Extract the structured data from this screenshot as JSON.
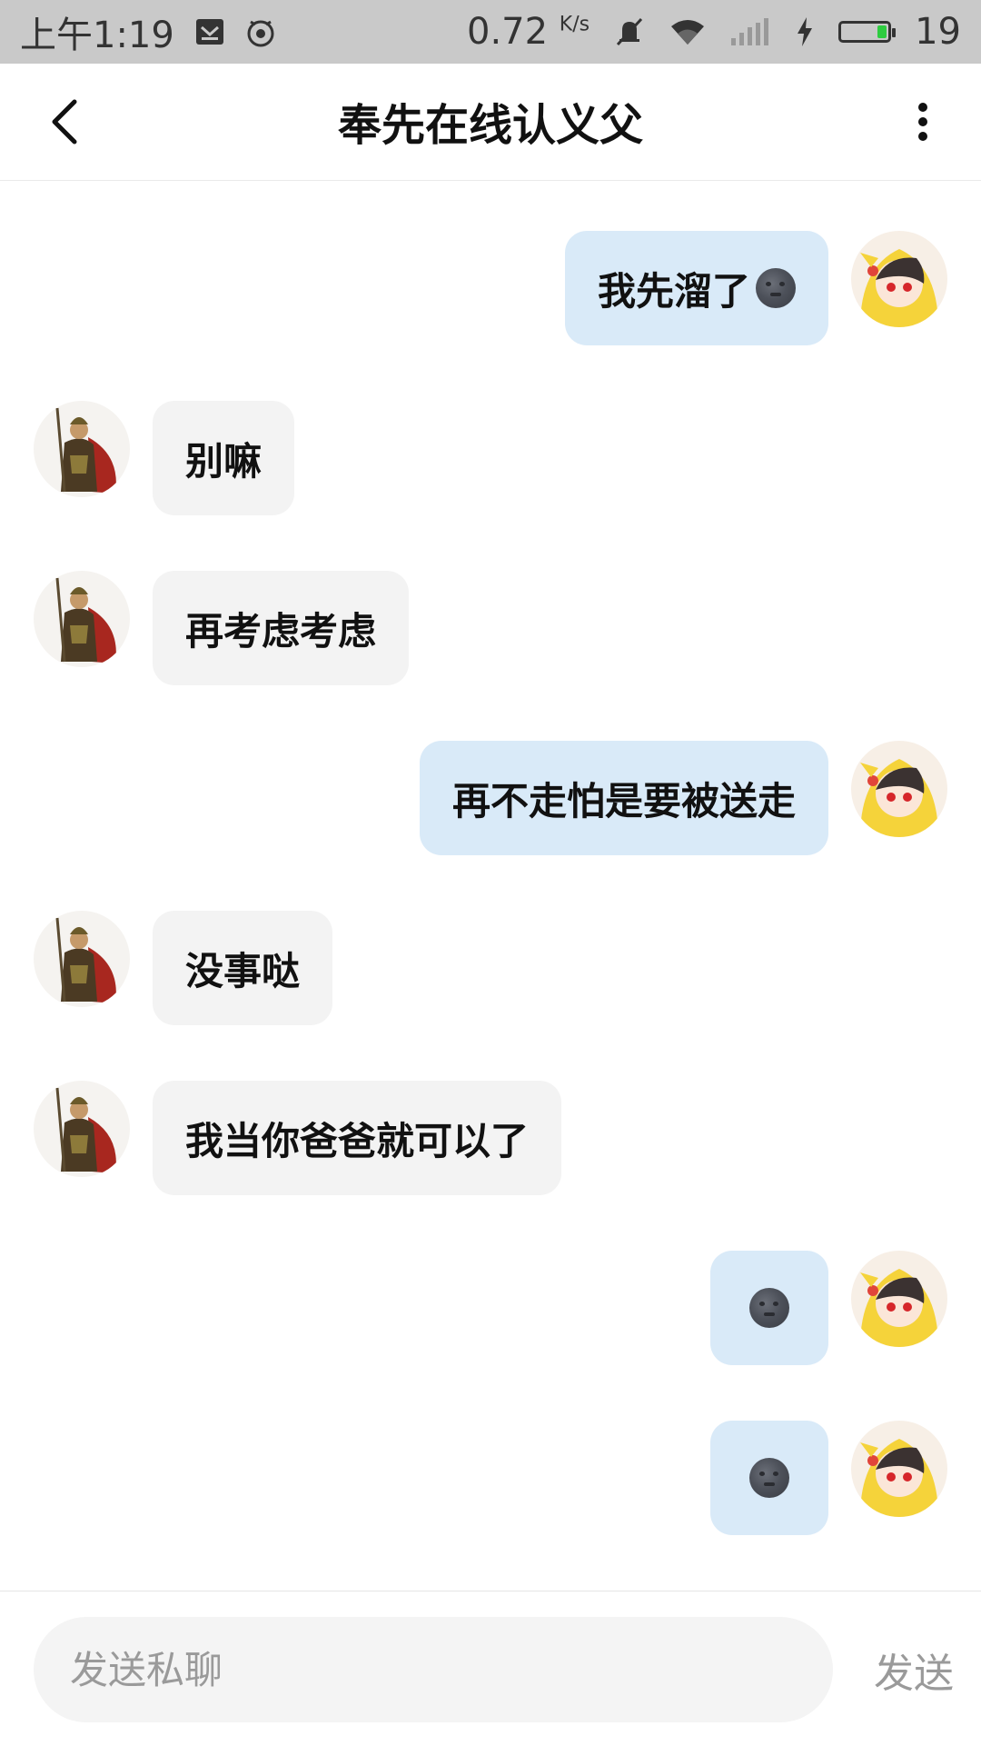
{
  "status_bar": {
    "time": "上午1:19",
    "network_speed": "0.72",
    "speed_unit": "K/s",
    "battery_level": "19",
    "icons": [
      "mail-icon",
      "owl-icon",
      "mute-bell-icon",
      "wifi-icon",
      "signal-icon",
      "charging-icon",
      "battery-icon"
    ]
  },
  "header": {
    "title": "奉先在线认义父",
    "back_icon": "chevron-left-icon",
    "more_icon": "more-vertical-icon"
  },
  "messages": [
    {
      "side": "right",
      "text": "我先溜了",
      "emoji": "new-moon-face"
    },
    {
      "side": "left",
      "text": "别嘛"
    },
    {
      "side": "left",
      "text": "再考虑考虑"
    },
    {
      "side": "right",
      "text": "再不走怕是要被送走"
    },
    {
      "side": "left",
      "text": "没事哒"
    },
    {
      "side": "left",
      "text": "我当你爸爸就可以了"
    },
    {
      "side": "right",
      "text": "",
      "emoji": "new-moon-face"
    },
    {
      "side": "right",
      "text": "",
      "emoji": "new-moon-face"
    }
  ],
  "input": {
    "placeholder": "发送私聊",
    "send_label": "发送"
  },
  "colors": {
    "status_bar_bg": "#c9c9c9",
    "sent_bubble": "#d9eaf8",
    "received_bubble": "#f3f3f3",
    "battery_green": "#2ecc40"
  }
}
